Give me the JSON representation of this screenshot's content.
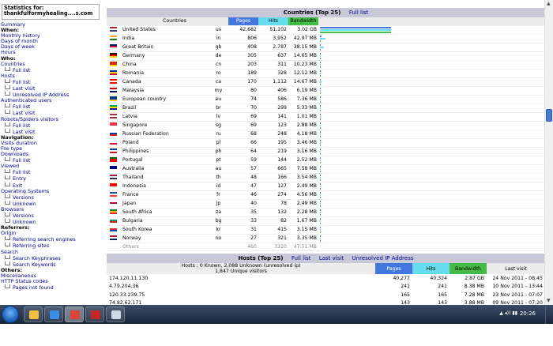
{
  "sidebar": {
    "stats_for_label": "Statistics for:",
    "site": "thankfulformyhealing....s.com",
    "summary": "Summary",
    "when": "When:",
    "monthly_history": "Monthly history",
    "days_of_month": "Days of month",
    "days_of_week": "Days of week",
    "hours": "Hours",
    "who": "Who:",
    "countries": "Countries",
    "countries_full_list": "Full list",
    "hosts": "Hosts",
    "hosts_full_list": "Full list",
    "hosts_last_visit": "Last visit",
    "hosts_unresolved": "Unresolved IP Address",
    "auth_users": "Authenticated users",
    "auth_full_list": "Full list",
    "auth_last_visit": "Last visit",
    "robots": "Robots/Spiders visitors",
    "robots_full_list": "Full list",
    "robots_last_visit": "Last visit",
    "navigation": "Navigation:",
    "visits_duration": "Visits duration",
    "file_type": "File type",
    "downloads": "Downloads",
    "downloads_full_list": "Full list",
    "viewed": "Viewed",
    "viewed_full_list": "Full list",
    "viewed_entry": "Entry",
    "viewed_exit": "Exit",
    "os": "Operating Systems",
    "os_versions": "Versions",
    "os_unknown": "Unknown",
    "browsers": "Browsers",
    "browsers_versions": "Versions",
    "browsers_unknown": "Unknown",
    "referrers": "Referrers:",
    "origin": "Origin",
    "referring_engines": "Referring search engines",
    "referring_sites": "Referring sites",
    "search": "Search",
    "search_keyphrases": "Search Keyphrases",
    "search_keywords": "Search Keywords",
    "others": "Others:",
    "miscellaneous": "Miscellaneous",
    "http_status": "HTTP Status codes",
    "pages_not_found": "Pages not found"
  },
  "countries": {
    "title": "Countries (Top 25)",
    "full_list_link": "Full list",
    "headers": {
      "country": "Countries",
      "pages": "Pages",
      "hits": "Hits",
      "bandwidth": "Bandwidth"
    },
    "rows": [
      {
        "name": "United States",
        "code": "us",
        "pages": "42,682",
        "hits": "51,102",
        "bw": "3.02 GB",
        "flag": [
          "#b22234",
          "#ffffff",
          "#3c3b6e"
        ],
        "bar_pages": 1.0,
        "bar_hits": 1.0,
        "bar_bw": 1.0
      },
      {
        "name": "India",
        "code": "in",
        "pages": "806",
        "hits": "3,952",
        "bw": "42.97 MB",
        "flag": [
          "#ff9933",
          "#ffffff",
          "#138808"
        ],
        "bar_pages": 0.02,
        "bar_hits": 0.08,
        "bar_bw": 0.014
      },
      {
        "name": "Great Britain",
        "code": "gb",
        "pages": "408",
        "hits": "2,787",
        "bw": "38.15 MB",
        "flag": [
          "#012169",
          "#c8102e",
          "#ffffff"
        ],
        "bar_pages": 0.01,
        "bar_hits": 0.055,
        "bar_bw": 0.012
      },
      {
        "name": "Germany",
        "code": "de",
        "pages": "305",
        "hits": "637",
        "bw": "14.65 MB",
        "flag": [
          "#000000",
          "#dd0000",
          "#ffce00"
        ],
        "bar_pages": 0.007,
        "bar_hits": 0.012,
        "bar_bw": 0.005
      },
      {
        "name": "China",
        "code": "cn",
        "pages": "203",
        "hits": "311",
        "bw": "10.23 MB",
        "flag": [
          "#de2910",
          "#de2910",
          "#ffde00"
        ],
        "bar_pages": 0.005,
        "bar_hits": 0.006,
        "bar_bw": 0.003
      },
      {
        "name": "Romania",
        "code": "ro",
        "pages": "189",
        "hits": "328",
        "bw": "12.12 MB",
        "flag": [
          "#002b7f",
          "#fcd116",
          "#ce1126"
        ],
        "bar_pages": 0.004,
        "bar_hits": 0.006,
        "bar_bw": 0.004
      },
      {
        "name": "Canada",
        "code": "ca",
        "pages": "170",
        "hits": "1,112",
        "bw": "14.67 MB",
        "flag": [
          "#ff0000",
          "#ffffff",
          "#ff0000"
        ],
        "bar_pages": 0.004,
        "bar_hits": 0.022,
        "bar_bw": 0.005
      },
      {
        "name": "Malaysia",
        "code": "my",
        "pages": "80",
        "hits": "406",
        "bw": "6.19 MB",
        "flag": [
          "#cc0001",
          "#ffffff",
          "#010066"
        ],
        "bar_pages": 0.002,
        "bar_hits": 0.008,
        "bar_bw": 0.002
      },
      {
        "name": "European country",
        "code": "eu",
        "pages": "74",
        "hits": "586",
        "bw": "7.36 MB",
        "flag": [
          "#003399",
          "#003399",
          "#ffcc00"
        ],
        "bar_pages": 0.002,
        "bar_hits": 0.011,
        "bar_bw": 0.002
      },
      {
        "name": "Brazil",
        "code": "br",
        "pages": "70",
        "hits": "299",
        "bw": "5.33 MB",
        "flag": [
          "#009c3b",
          "#ffdf00",
          "#002776"
        ],
        "bar_pages": 0.002,
        "bar_hits": 0.006,
        "bar_bw": 0.002
      },
      {
        "name": "Latvia",
        "code": "lv",
        "pages": "69",
        "hits": "141",
        "bw": "1.01 MB",
        "flag": [
          "#9e3039",
          "#ffffff",
          "#9e3039"
        ],
        "bar_pages": 0.002,
        "bar_hits": 0.003,
        "bar_bw": 0.001
      },
      {
        "name": "Singapore",
        "code": "sg",
        "pages": "69",
        "hits": "123",
        "bw": "2.88 MB",
        "flag": [
          "#ef3340",
          "#ef3340",
          "#ffffff"
        ],
        "bar_pages": 0.002,
        "bar_hits": 0.002,
        "bar_bw": 0.001
      },
      {
        "name": "Russian Federation",
        "code": "ru",
        "pages": "68",
        "hits": "248",
        "bw": "4.18 MB",
        "flag": [
          "#ffffff",
          "#0039a6",
          "#d52b1e"
        ],
        "bar_pages": 0.002,
        "bar_hits": 0.005,
        "bar_bw": 0.001
      },
      {
        "name": "Poland",
        "code": "pl",
        "pages": "66",
        "hits": "195",
        "bw": "3.46 MB",
        "flag": [
          "#ffffff",
          "#ffffff",
          "#dc143c"
        ],
        "bar_pages": 0.002,
        "bar_hits": 0.004,
        "bar_bw": 0.001
      },
      {
        "name": "Philippines",
        "code": "ph",
        "pages": "64",
        "hits": "219",
        "bw": "3.16 MB",
        "flag": [
          "#0038a8",
          "#ffffff",
          "#ce1126"
        ],
        "bar_pages": 0.001,
        "bar_hits": 0.004,
        "bar_bw": 0.001
      },
      {
        "name": "Portugal",
        "code": "pt",
        "pages": "59",
        "hits": "144",
        "bw": "2.52 MB",
        "flag": [
          "#006600",
          "#ff0000",
          "#ff0000"
        ],
        "bar_pages": 0.001,
        "bar_hits": 0.003,
        "bar_bw": 0.001
      },
      {
        "name": "Australia",
        "code": "au",
        "pages": "57",
        "hits": "665",
        "bw": "7.58 MB",
        "flag": [
          "#00008b",
          "#00008b",
          "#ffffff"
        ],
        "bar_pages": 0.001,
        "bar_hits": 0.013,
        "bar_bw": 0.002
      },
      {
        "name": "Thailand",
        "code": "th",
        "pages": "48",
        "hits": "166",
        "bw": "3.54 MB",
        "flag": [
          "#a51931",
          "#f4f5f8",
          "#2d2a4a"
        ],
        "bar_pages": 0.001,
        "bar_hits": 0.003,
        "bar_bw": 0.001
      },
      {
        "name": "Indonesia",
        "code": "id",
        "pages": "47",
        "hits": "127",
        "bw": "2.49 MB",
        "flag": [
          "#ff0000",
          "#ff0000",
          "#ffffff"
        ],
        "bar_pages": 0.001,
        "bar_hits": 0.002,
        "bar_bw": 0.001
      },
      {
        "name": "France",
        "code": "fr",
        "pages": "46",
        "hits": "274",
        "bw": "4.56 MB",
        "flag": [
          "#0055a4",
          "#ffffff",
          "#ef4135"
        ],
        "bar_pages": 0.001,
        "bar_hits": 0.005,
        "bar_bw": 0.001
      },
      {
        "name": "Japan",
        "code": "jp",
        "pages": "40",
        "hits": "78",
        "bw": "2.49 MB",
        "flag": [
          "#ffffff",
          "#bc002d",
          "#ffffff"
        ],
        "bar_pages": 0.001,
        "bar_hits": 0.002,
        "bar_bw": 0.001
      },
      {
        "name": "South Africa",
        "code": "za",
        "pages": "35",
        "hits": "132",
        "bw": "2.28 MB",
        "flag": [
          "#007a4d",
          "#ffb612",
          "#de3831"
        ],
        "bar_pages": 0.001,
        "bar_hits": 0.003,
        "bar_bw": 0.001
      },
      {
        "name": "Bulgaria",
        "code": "bg",
        "pages": "33",
        "hits": "82",
        "bw": "1.67 MB",
        "flag": [
          "#ffffff",
          "#00966e",
          "#d62612"
        ],
        "bar_pages": 0.001,
        "bar_hits": 0.002,
        "bar_bw": 0.001
      },
      {
        "name": "South Korea",
        "code": "kr",
        "pages": "31",
        "hits": "415",
        "bw": "3.15 MB",
        "flag": [
          "#ffffff",
          "#cd2e3a",
          "#0047a0"
        ],
        "bar_pages": 0.001,
        "bar_hits": 0.008,
        "bar_bw": 0.001
      },
      {
        "name": "Norway",
        "code": "no",
        "pages": "27",
        "hits": "321",
        "bw": "3.35 MB",
        "flag": [
          "#ba0c2f",
          "#ffffff",
          "#00205b"
        ],
        "bar_pages": 0.001,
        "bar_hits": 0.006,
        "bar_bw": 0.001
      }
    ],
    "others": {
      "name": "Others",
      "pages": "460",
      "hits": "3320",
      "bw": "47.51 MB"
    }
  },
  "hosts": {
    "title": "Hosts (Top 25)",
    "full_list_link": "Full list",
    "last_visit_link": "Last visit",
    "unresolved_link": "Unresolved IP Address",
    "summary_line1": "Hosts : 0 Known, 2,088 Unknown (unresolved ip)",
    "summary_line2": "1,847 Unique visitors",
    "headers": {
      "pages": "Pages",
      "hits": "Hits",
      "bandwidth": "Bandwidth",
      "last_visit": "Last visit"
    },
    "rows": [
      {
        "host": "174.120.11.130",
        "pages": "40,277",
        "hits": "40,324",
        "bw": "2.87 GB",
        "last": "24 Nov 2011 - 08:45"
      },
      {
        "host": "4.79.204.36",
        "pages": "241",
        "hits": "241",
        "bw": "8.38 MB",
        "last": "10 Nov 2011 - 13:44"
      },
      {
        "host": "120.33.239.75",
        "pages": "165",
        "hits": "165",
        "bw": "7.28 MB",
        "last": "23 Nov 2011 - 07:07"
      },
      {
        "host": "74.82.62.171",
        "pages": "143",
        "hits": "143",
        "bw": "3.88 MB",
        "last": "09 Nov 2011 - 07:20"
      }
    ]
  },
  "taskbar": {
    "clock": "20:26",
    "tray": "▲ ◂)) ▮▮",
    "apps": [
      {
        "name": "explorer",
        "color": "#f0c040"
      },
      {
        "name": "ie",
        "color": "#3a8ee6"
      },
      {
        "name": "chrome",
        "color": "#db4437"
      },
      {
        "name": "filezilla",
        "color": "#c62828"
      },
      {
        "name": "window",
        "color": "#cfd8e6"
      }
    ]
  },
  "colors": {
    "pages": "#4477dd",
    "hits": "#66ddee",
    "bandwidth": "#44bb44"
  }
}
